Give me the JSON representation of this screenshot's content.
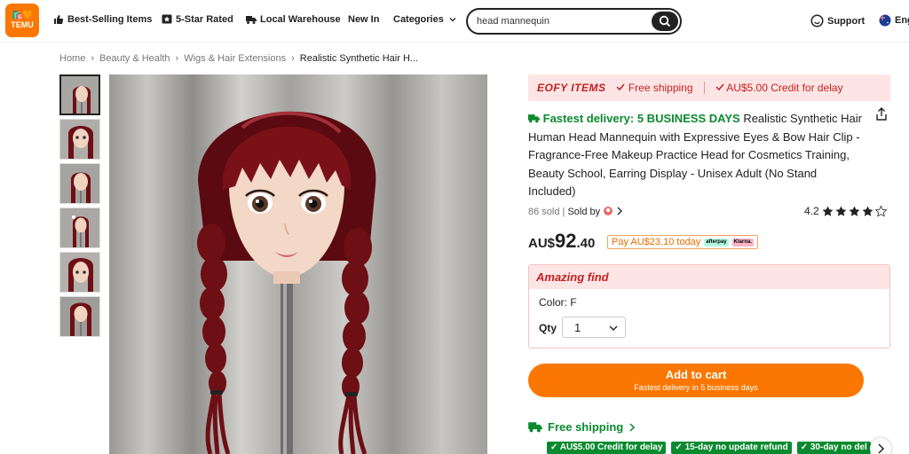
{
  "header": {
    "logo_line1": "🛍️🧡",
    "logo_line2": "TEMU",
    "nav": {
      "best_selling": "Best-Selling Items",
      "five_star": "5-Star Rated",
      "local_warehouse": "Local Warehouse",
      "new_in": "New In",
      "categories": "Categories"
    },
    "search": {
      "value": "head mannequin"
    },
    "support": "Support",
    "lang": "Eng"
  },
  "breadcrumb": [
    "Home",
    "Beauty & Health",
    "Wigs & Hair Extensions",
    "Realistic Synthetic Hair H..."
  ],
  "promo": {
    "brand": "EOFY ITEMS",
    "item1": "Free shipping",
    "item2": "AU$5.00 Credit for delay"
  },
  "product": {
    "fast_delivery": "Fastest delivery: 5 BUSINESS DAYS",
    "title": "Realistic Synthetic Hair Human Head Mannequin with Expressive Eyes & Bow Hair Clip - Fragrance-Free Makeup Practice Head for Cosmetics Training, Beauty School, Earring Display - Unisex Adult (No Stand Included)",
    "sold": "86 sold",
    "sold_by": "Sold by",
    "rating": "4.2",
    "rating_value": 4.2,
    "price_currency": "AU$",
    "price_whole": "92",
    "price_decimal": ".40",
    "pay_later": "Pay AU$23.10 today",
    "badge1": "afterpay",
    "badge2": "Klarna."
  },
  "options": {
    "header": "Amazing find",
    "color": "Color: F",
    "qty_label": "Qty",
    "qty_value": "1"
  },
  "cart": {
    "label": "Add to cart",
    "sub": "Fastest delivery in 5 business days"
  },
  "shipping": {
    "label": "Free shipping",
    "chips": [
      "AU$5.00 Credit for delay",
      "15-day no update refund",
      "30-day no del"
    ]
  },
  "colors": {
    "brand_orange": "#fb7701",
    "promo_red": "#c51f1f",
    "green": "#0a8a2f"
  }
}
